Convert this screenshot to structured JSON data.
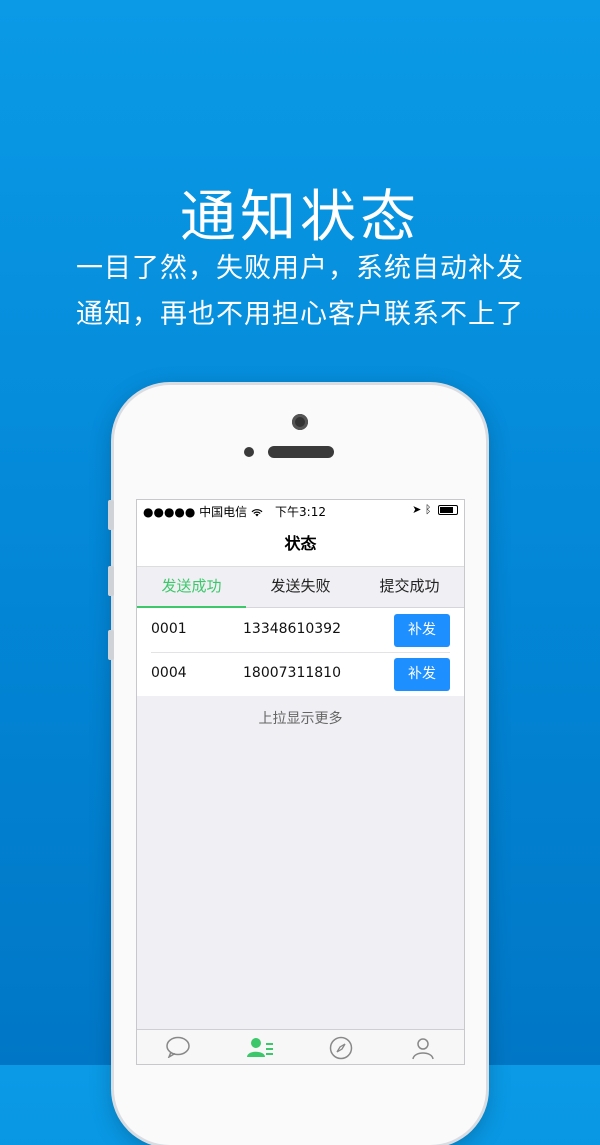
{
  "hero": {
    "title": "通知状态",
    "line1": "一目了然，失败用户，系统自动补发",
    "line2": "通知，再也不用担心客户联系不上了"
  },
  "status_bar": {
    "carrier": "●●●●● 中国电信",
    "time": "下午3:12"
  },
  "nav": {
    "title": "状态"
  },
  "tabs": [
    {
      "label": "发送成功",
      "active": true
    },
    {
      "label": "发送失败",
      "active": false
    },
    {
      "label": "提交成功",
      "active": false
    }
  ],
  "rows": [
    {
      "id": "0001",
      "phone": "13348610392",
      "action": "补发"
    },
    {
      "id": "0004",
      "phone": "18007311810",
      "action": "补发"
    }
  ],
  "more_text": "上拉显示更多",
  "tabbar_icons": [
    "chat-icon",
    "contacts-icon",
    "compass-icon",
    "profile-icon"
  ],
  "colors": {
    "accent_green": "#3cc86a",
    "button_blue": "#1e8fff",
    "background_blue": "#0a9ae6"
  }
}
